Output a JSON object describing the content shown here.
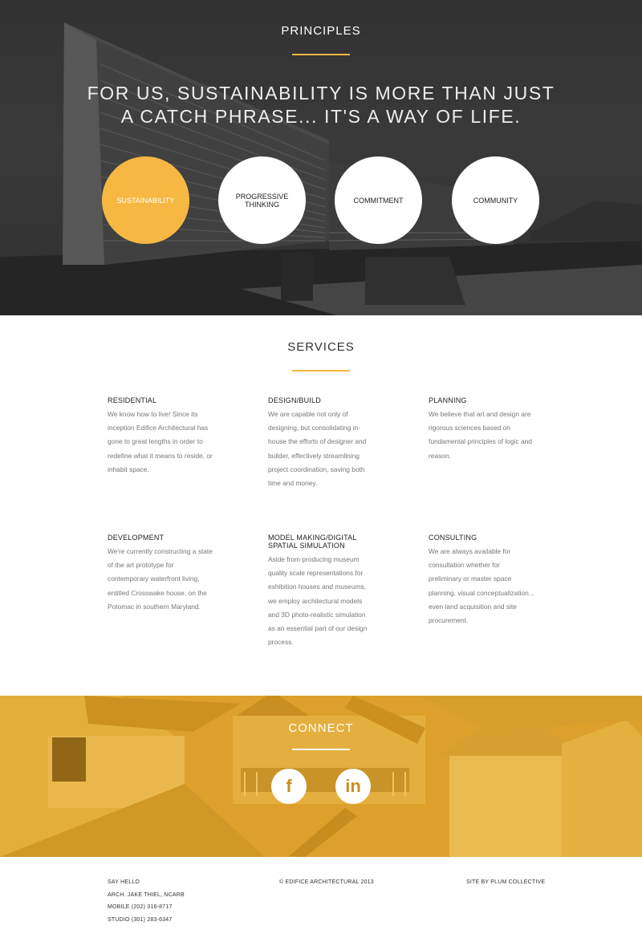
{
  "principles": {
    "title": "PRINCIPLES",
    "tagline_line1": "FOR US, SUSTAINABILITY IS MORE THAN JUST",
    "tagline_line2": "A CATCH PHRASE... IT'S A WAY OF LIFE.",
    "pills": [
      {
        "label": "SUSTAINABILITY",
        "active": true
      },
      {
        "label": "PROGRESSIVE THINKING",
        "active": false
      },
      {
        "label": "COMMITMENT",
        "active": false
      },
      {
        "label": "COMMUNITY",
        "active": false
      }
    ]
  },
  "services": {
    "title": "SERVICES",
    "items": [
      {
        "title": "RESIDENTIAL",
        "body": "We know how to live! Since its inception Edifice Architectural has gone to great lengths in order to redefine what it means to reside, or inhabit space."
      },
      {
        "title": "DESIGN/BUILD",
        "body": "We are capable not only of designing, but consolidating in-house the efforts of designer and builder, effectively streamlining project coordination, saving both time and money."
      },
      {
        "title": "PLANNING",
        "body": "We believe that art and design are rigorous sciences based on fundamental principles of logic and reason."
      },
      {
        "title": "DEVELOPMENT",
        "body": "We're currently constructing a state of the art prototype for contemporary waterfront living, entitled Crosswake house, on the Potomac in southern Maryland."
      },
      {
        "title": "MODEL MAKING/DIGITAL SPATIAL SIMULATION",
        "body": "Aside from producing museum quality scale representations for exhibition houses and museums, we employ architectural models and 3D photo-realistic simulation as an essential part of our design process."
      },
      {
        "title": "CONSULTING",
        "body": "We are always available for consultation whether for preliminary or master space planning, visual conceptualization... even land acquisition and site procurement."
      }
    ]
  },
  "connect": {
    "title": "CONNECT",
    "facebook_glyph": "f",
    "linkedin_glyph": "in"
  },
  "footer": {
    "say_hello": "SAY HELLO",
    "name": "ARCH. JAKE THIEL, NCARB",
    "mobile": "MOBILE (202) 316-8717",
    "studio": "STUDIO (301) 283-6347",
    "copyright": "© EDIFICE ARCHITECTURAL 2013",
    "credit": "SITE BY PLUM COLLECTIVE"
  },
  "colors": {
    "accent": "#f6b842",
    "hero_dark": "#444444",
    "connect_gold": "#e0a52f"
  }
}
